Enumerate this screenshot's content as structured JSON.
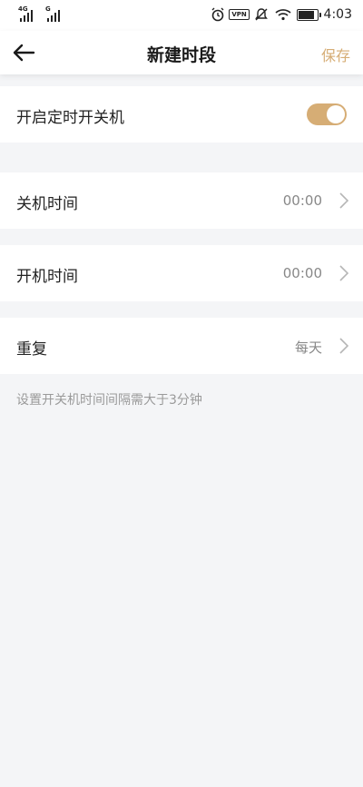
{
  "status_bar": {
    "sim1_network": "4G",
    "sim2_network": "G",
    "icons": [
      "alarm-icon",
      "vpn-icon",
      "mute-icon",
      "wifi-icon",
      "battery-icon"
    ],
    "vpn_text": "VPN",
    "time": "4:03"
  },
  "app_bar": {
    "back_icon": "arrow-left-icon",
    "title": "新建时段",
    "save_label": "保存"
  },
  "settings": {
    "power_schedule": {
      "label": "开启定时开关机",
      "enabled": true
    },
    "shutdown_time": {
      "label": "关机时间",
      "value": "00:00"
    },
    "startup_time": {
      "label": "开机时间",
      "value": "00:00"
    },
    "repeat": {
      "label": "重复",
      "value": "每天"
    }
  },
  "hint": "设置开关机时间间隔需大于3分钟",
  "colors": {
    "accent": "#d6ad75",
    "background": "#f4f5f7",
    "card": "#ffffff",
    "secondary_text": "#888888"
  }
}
